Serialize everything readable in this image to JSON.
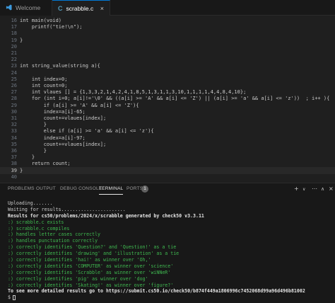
{
  "tabs": [
    {
      "label": "Welcome",
      "active": false,
      "icon": "vscode-icon"
    },
    {
      "label": "scrabble.c",
      "active": true,
      "icon": "c-file-icon",
      "close": "×"
    }
  ],
  "editor": {
    "lines": [
      {
        "n": "16",
        "text": "int main(void)"
      },
      {
        "n": "17",
        "text": "    printf(\"tie!\\n\");"
      },
      {
        "n": "18",
        "text": ""
      },
      {
        "n": "19",
        "text": "}"
      },
      {
        "n": "20",
        "text": ""
      },
      {
        "n": "21",
        "text": ""
      },
      {
        "n": "22",
        "text": ""
      },
      {
        "n": "23",
        "text": "int string_value(string a){"
      },
      {
        "n": "24",
        "text": ""
      },
      {
        "n": "25",
        "text": "    int index=0;"
      },
      {
        "n": "26",
        "text": "    int count=0;"
      },
      {
        "n": "27",
        "text": "    int vlaues [] = {1,3,3,2,1,4,2,4,1,8,5,1,3,1,1,3,10,1,1,1,1,4,4,8,4,10};"
      },
      {
        "n": "28",
        "text": "    for (int i=0; a[i]!='\\0' && ((a[i] >= 'A' && a[i] <= 'Z') || (a[i] >= 'a' && a[i] <= 'z'))  ; i++ ){"
      },
      {
        "n": "29",
        "text": "        if (a[i] >= 'A' && a[i] <= 'Z'){"
      },
      {
        "n": "30",
        "text": "        index=a[i]-65;"
      },
      {
        "n": "31",
        "text": "        count+=vlaues[index];"
      },
      {
        "n": "32",
        "text": "        }"
      },
      {
        "n": "33",
        "text": "        else if (a[i] >= 'a' && a[i] <= 'z'){"
      },
      {
        "n": "34",
        "text": "        index=a[i]-97;"
      },
      {
        "n": "35",
        "text": "        count+=vlaues[index];"
      },
      {
        "n": "36",
        "text": "        }"
      },
      {
        "n": "37",
        "text": "    }"
      },
      {
        "n": "38",
        "text": "    return count;"
      },
      {
        "n": "39",
        "text": "}"
      },
      {
        "n": "40",
        "text": ""
      }
    ],
    "current_line": "39"
  },
  "panel": {
    "tabs": [
      "PROBLEMS",
      "OUTPUT",
      "DEBUG CONSOLE",
      "TERMINAL",
      "PORTS"
    ],
    "active_tab": "TERMINAL",
    "ports_count": "1",
    "icons": [
      "add-terminal-icon",
      "chevron-down-icon",
      "more-icon",
      "maximize-icon",
      "close-icon"
    ]
  },
  "terminal": {
    "lines": [
      {
        "text": "Uploading.......",
        "style": "plain"
      },
      {
        "text": "Waiting for results.......................",
        "style": "plain"
      },
      {
        "text": "Results for cs50/problems/2024/x/scrabble generated by check50 v3.3.11",
        "style": "bold"
      },
      {
        "text": ":) scrabble.c exists",
        "style": "green"
      },
      {
        "text": ":) scrabble.c compiles",
        "style": "green"
      },
      {
        "text": ":) handles letter cases correctly",
        "style": "green"
      },
      {
        "text": ":) handles punctuation correctly",
        "style": "green"
      },
      {
        "text": ":) correctly identifies 'Question?' and 'Question!' as a tie",
        "style": "green"
      },
      {
        "text": ":) correctly identifies 'drawing' and 'illustration' as a tie",
        "style": "green"
      },
      {
        "text": ":) correctly identifies 'hai!' as winner over 'Oh,'",
        "style": "green"
      },
      {
        "text": ":) correctly identifies 'COMPUTER' as winner over 'science'",
        "style": "green"
      },
      {
        "text": ":) correctly identifies 'Scrabble' as winner over 'wiNNeR'",
        "style": "green"
      },
      {
        "text": ":) correctly identifies 'pig' as winner over 'dog'",
        "style": "green"
      },
      {
        "text": ":) correctly identifies 'Skating!' as winner over 'figure?'",
        "style": "green"
      },
      {
        "text": "To see more detailed results go to https://submit.cs50.io/check50/b874f449a1806996c7452068d99a96d496b81002",
        "style": "bold"
      }
    ],
    "prompt": "$"
  },
  "colors": {
    "accent": "#0078d4",
    "pass_green": "#3fb950",
    "background": "#1f1f1f"
  }
}
